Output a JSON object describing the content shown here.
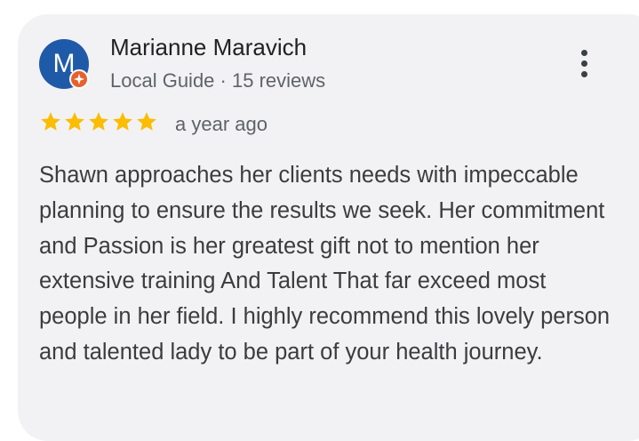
{
  "review": {
    "author": "Marianne Maravich",
    "avatar_initial": "M",
    "badge": "Local Guide",
    "review_count": "15 reviews",
    "rating": 5,
    "time": "a year ago",
    "text": "Shawn approaches her clients needs with impeccable planning to ensure the results we seek. Her commitment and Passion is her greatest gift not to mention her extensive training And Talent That far exceed most people in her field. I highly recommend this lovely person and talented lady to be part of your health journey."
  },
  "colors": {
    "avatar": "#1f5aa8",
    "badge": "#e8612c",
    "star": "#fbbc04",
    "card": "#f2f2f4"
  },
  "icons": {
    "more": "more-vert-icon",
    "badge": "local-guide-icon",
    "star": "star-icon"
  }
}
